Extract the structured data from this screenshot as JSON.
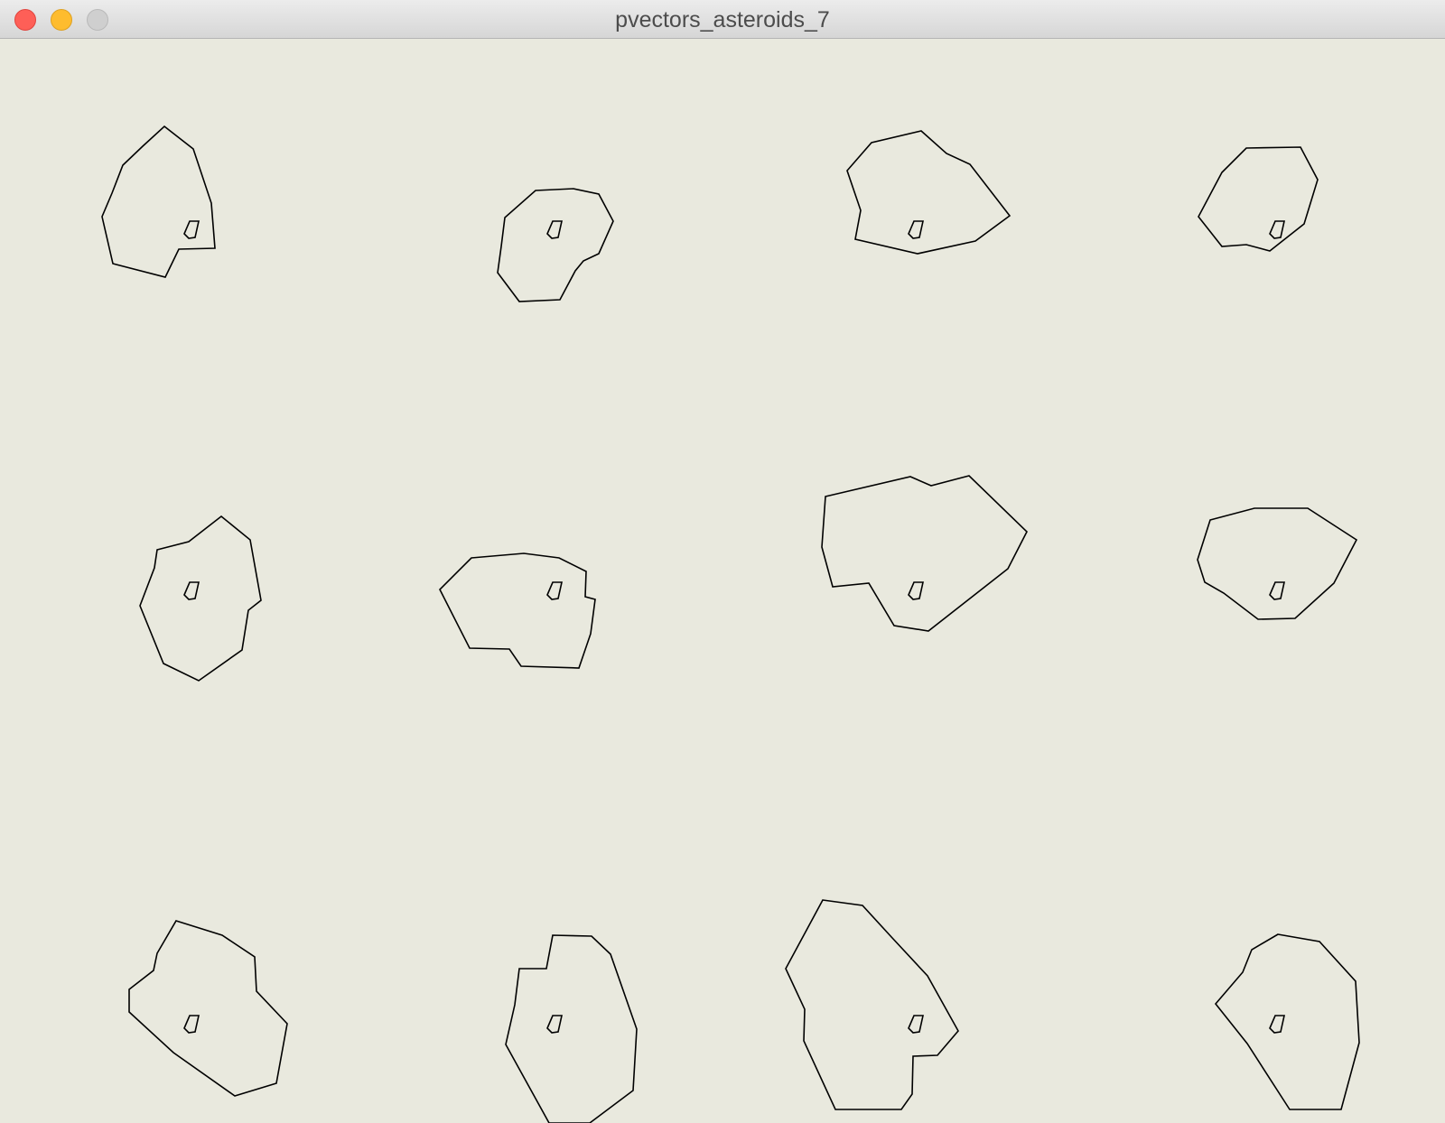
{
  "window": {
    "title": "pvectors_asteroids_7"
  },
  "colors": {
    "canvas_background": "#e9e9de",
    "stroke": "#000000",
    "close_button": "#fe5f57",
    "minimize_button": "#febc2e",
    "zoom_button": "#cfcfcf"
  },
  "icons": {
    "close": "close-icon",
    "minimize": "minimize-icon",
    "zoom": "zoom-icon"
  },
  "sketch": {
    "asteroid_count": 12
  }
}
